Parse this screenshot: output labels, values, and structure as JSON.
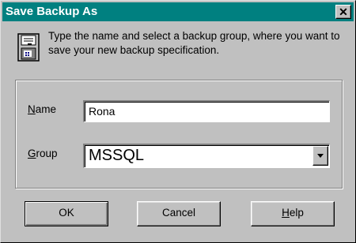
{
  "dialog": {
    "title": "Save Backup As",
    "close_label": "✕",
    "description": "Type the name and select a backup group, where you want to save your new backup specification.",
    "icon": "floppy-disk-icon"
  },
  "form": {
    "name": {
      "label_mnemonic": "N",
      "label_rest": "ame",
      "value": "Rona"
    },
    "group": {
      "label_mnemonic": "G",
      "label_rest": "roup",
      "value": "MSSQL"
    }
  },
  "buttons": {
    "ok": "OK",
    "cancel": "Cancel",
    "help_mnemonic": "H",
    "help_rest": "elp"
  },
  "colors": {
    "titlebar": "#008080",
    "face": "#c0c0c0"
  }
}
